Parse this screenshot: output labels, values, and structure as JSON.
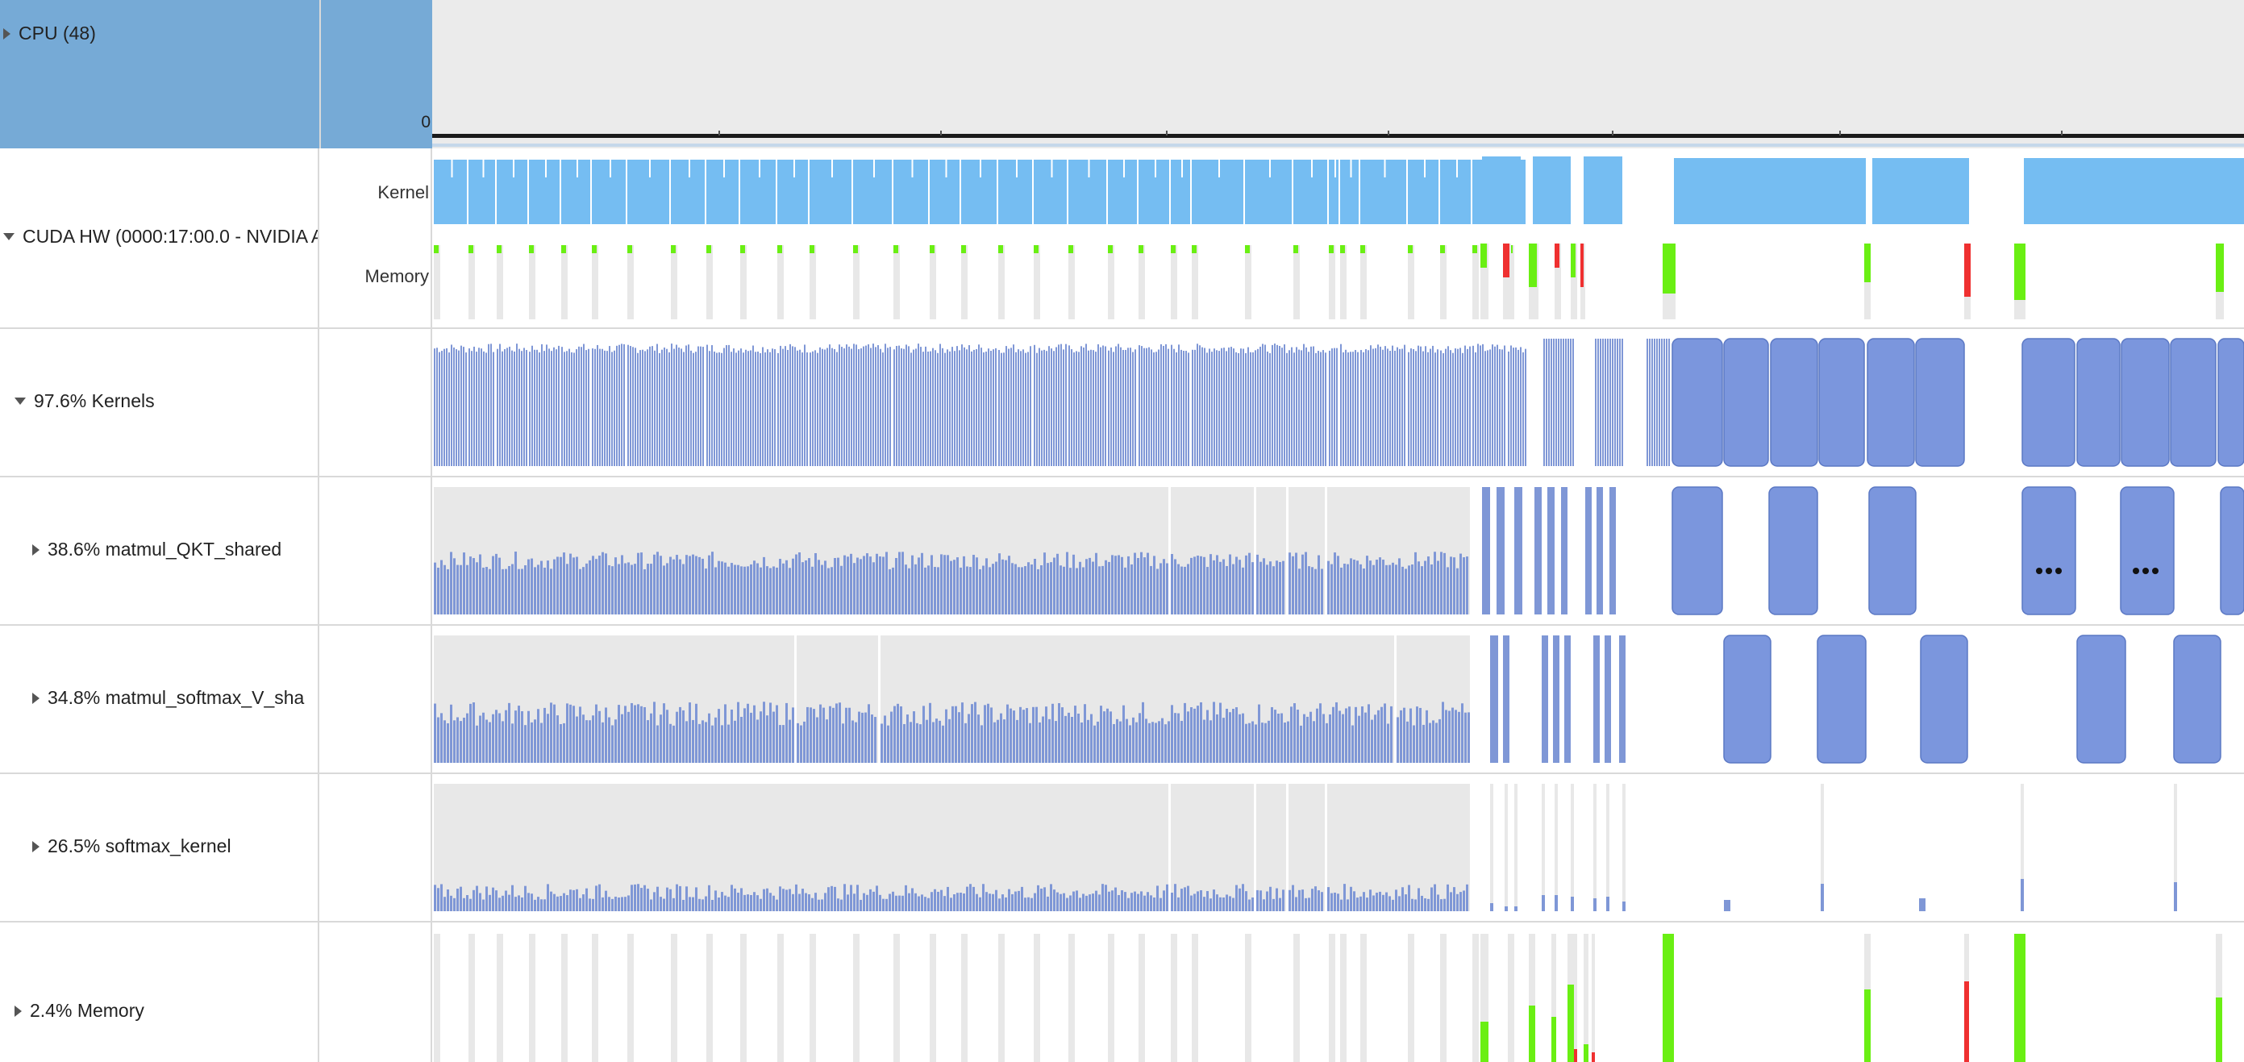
{
  "cpu": {
    "label": "CPU (48)",
    "axis_zero": "0",
    "header_color": "#76aad6",
    "track_bg": "#ebebeb"
  },
  "cuda": {
    "label": "CUDA HW (0000:17:00.0 - NVIDIA A",
    "kernel_label": "Kernel",
    "memory_label": "Memory"
  },
  "kernels": {
    "label": "97.6% Kernels"
  },
  "matmul_qkt": {
    "label": "38.6% matmul_QKT_shared"
  },
  "matmul_softmax": {
    "label": "34.8% matmul_softmax_V_sha"
  },
  "softmax": {
    "label": "26.5% softmax_kernel"
  },
  "memory": {
    "label": "2.4% Memory"
  },
  "icons": {
    "collapsed": "triangle-right-icon",
    "expanded": "triangle-down-icon",
    "more": "ellipsis-icon"
  },
  "colors": {
    "kernel_light": "#75bdf2",
    "kernel_dark": "#7f97d6",
    "kernel_block": "#7b96dd",
    "memory_green": "#6aef13",
    "memory_red": "#ef3030",
    "track_gray": "#e8e8e8"
  }
}
